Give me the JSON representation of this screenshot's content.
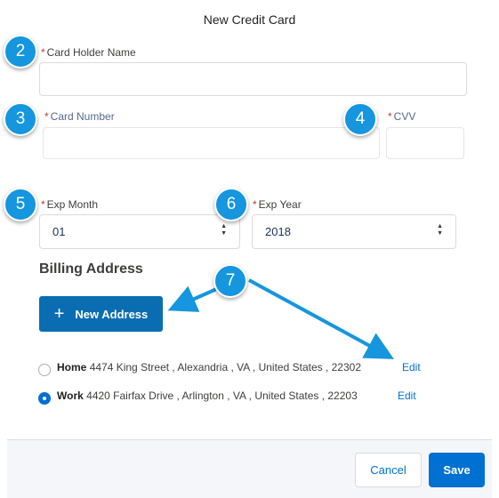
{
  "modal": {
    "title": "New Credit Card"
  },
  "fields": {
    "card_holder": {
      "label": "Card Holder Name",
      "value": ""
    },
    "card_number": {
      "label": "Card Number",
      "value": ""
    },
    "cvv": {
      "label": "CVV",
      "value": ""
    },
    "exp_month": {
      "label": "Exp Month",
      "value": "01"
    },
    "exp_year": {
      "label": "Exp Year",
      "value": "2018"
    }
  },
  "billing": {
    "title": "Billing Address",
    "new_address_label": "New Address",
    "addresses": [
      {
        "name": "Home",
        "text": "4474 King Street , Alexandria , VA , United States , 22302",
        "edit": "Edit",
        "selected": false
      },
      {
        "name": "Work",
        "text": "4420 Fairfax Drive , Arlington , VA , United States , 22203",
        "edit": "Edit",
        "selected": true
      }
    ]
  },
  "callouts": [
    "2",
    "3",
    "4",
    "5",
    "6",
    "7"
  ],
  "footer": {
    "cancel_label": "Cancel",
    "save_label": "Save"
  },
  "colors": {
    "badge": "#1596de",
    "brand": "#0070d2",
    "arrow": "#1596de",
    "required": "#c23934"
  }
}
